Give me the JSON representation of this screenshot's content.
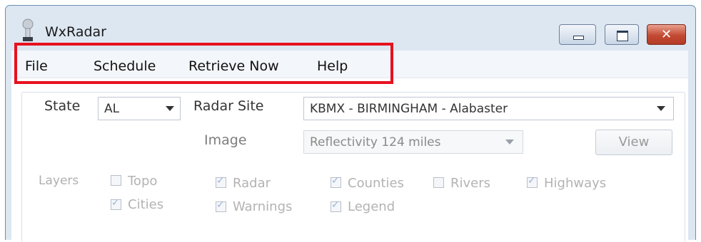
{
  "window": {
    "title": "WxRadar"
  },
  "menu": {
    "items": [
      "File",
      "Schedule",
      "Retrieve Now",
      "Help"
    ]
  },
  "form": {
    "state_label": "State",
    "state_value": "AL",
    "radar_site_label": "Radar Site",
    "radar_site_value": "KBMX - BIRMINGHAM - Alabaster",
    "image_label": "Image",
    "image_value": "Reflectivity 124 miles",
    "view_button": "View"
  },
  "layers": {
    "label": "Layers",
    "items": [
      {
        "label": "Topo",
        "checked": false
      },
      {
        "label": "Cities",
        "checked": true
      },
      {
        "label": "Radar",
        "checked": true
      },
      {
        "label": "Warnings",
        "checked": true
      },
      {
        "label": "Counties",
        "checked": true
      },
      {
        "label": "Legend",
        "checked": true
      },
      {
        "label": "Rivers",
        "checked": false
      },
      {
        "label": "Highways",
        "checked": true
      }
    ]
  },
  "colors": {
    "highlight": "#e8111f",
    "title_bar": "#dde7f2"
  }
}
